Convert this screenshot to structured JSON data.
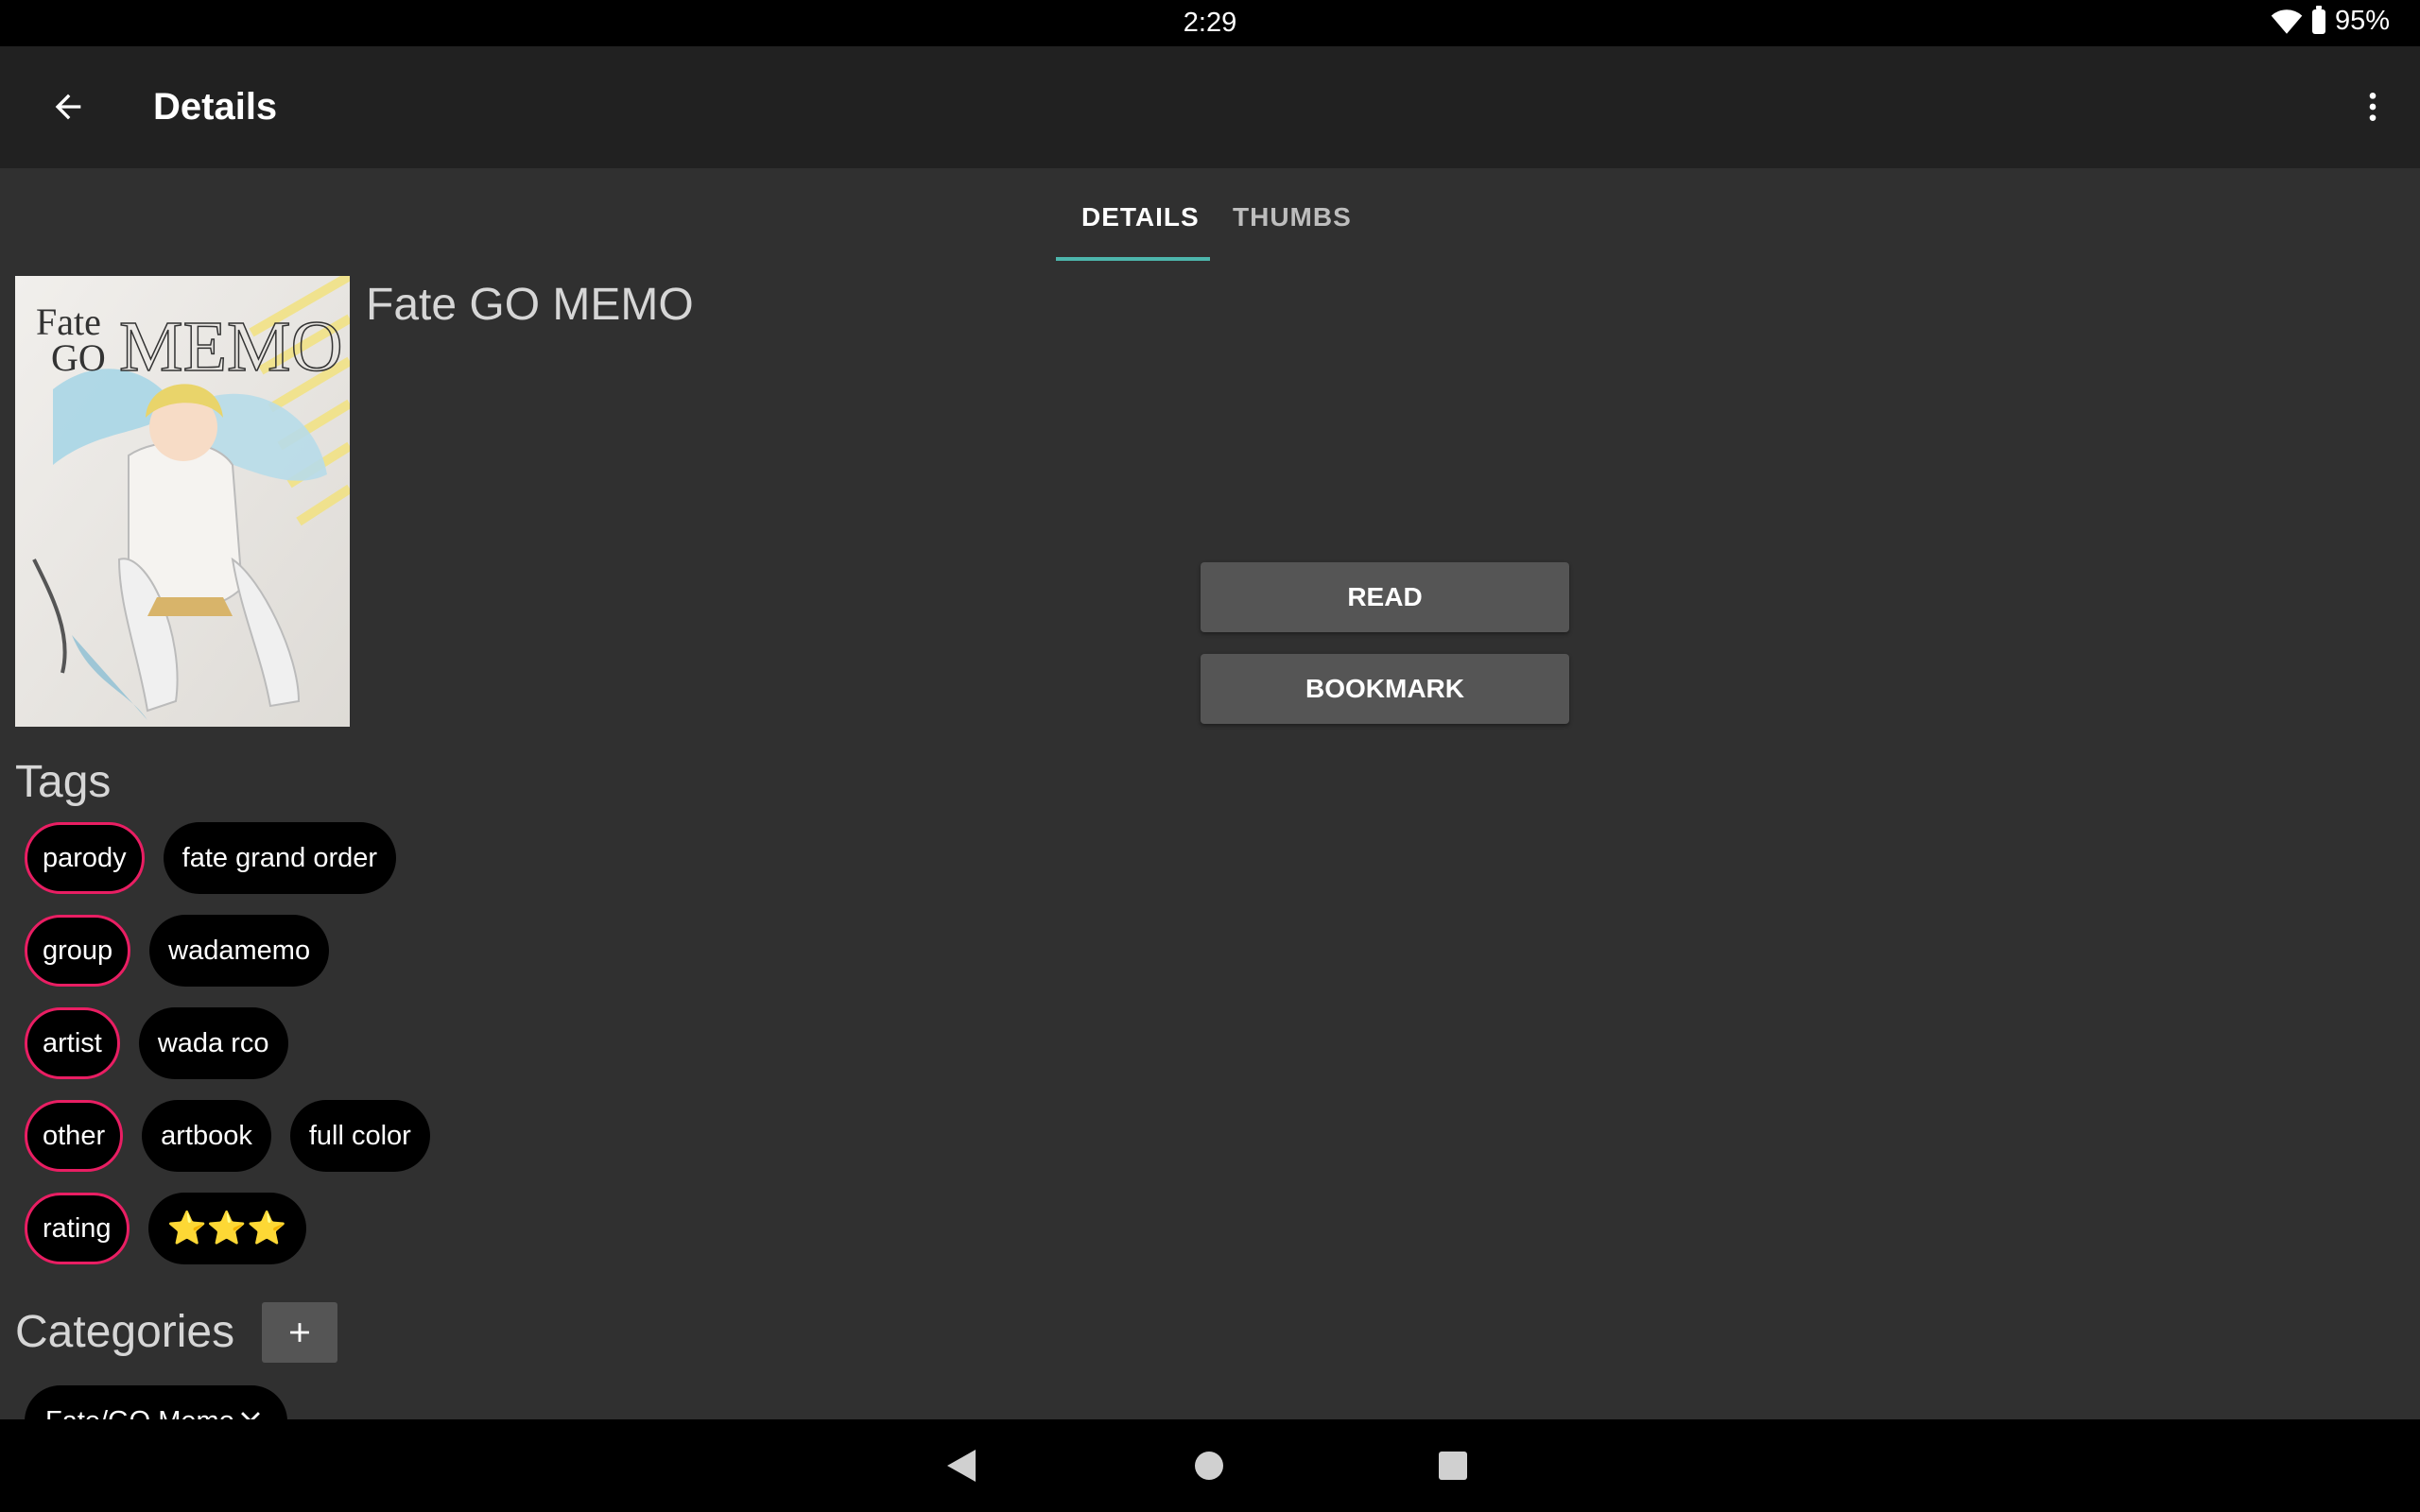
{
  "status": {
    "time": "2:29",
    "battery": "95%"
  },
  "appbar": {
    "title": "Details"
  },
  "tabs": [
    {
      "label": "DETAILS",
      "selected": true
    },
    {
      "label": "THUMBS",
      "selected": false
    }
  ],
  "gallery": {
    "title": "Fate GO MEMO",
    "cover_text": "Fate GO MEMO"
  },
  "buttons": {
    "read": "READ",
    "bookmark": "BOOKMARK"
  },
  "tags": {
    "title": "Tags",
    "rows": [
      {
        "namespace": "parody",
        "values": [
          "fate grand order"
        ]
      },
      {
        "namespace": "group",
        "values": [
          "wadamemo"
        ]
      },
      {
        "namespace": "artist",
        "values": [
          "wada rco"
        ]
      },
      {
        "namespace": "other",
        "values": [
          "artbook",
          "full color"
        ]
      },
      {
        "namespace": "rating",
        "values": [
          "⭐⭐⭐"
        ]
      }
    ]
  },
  "categories": {
    "title": "Categories",
    "items": [
      "Fate/GO Memo"
    ]
  },
  "colors": {
    "accent_tab": "#4db6ac",
    "namespace_border": "#e91e63",
    "star": "#fdd835"
  }
}
